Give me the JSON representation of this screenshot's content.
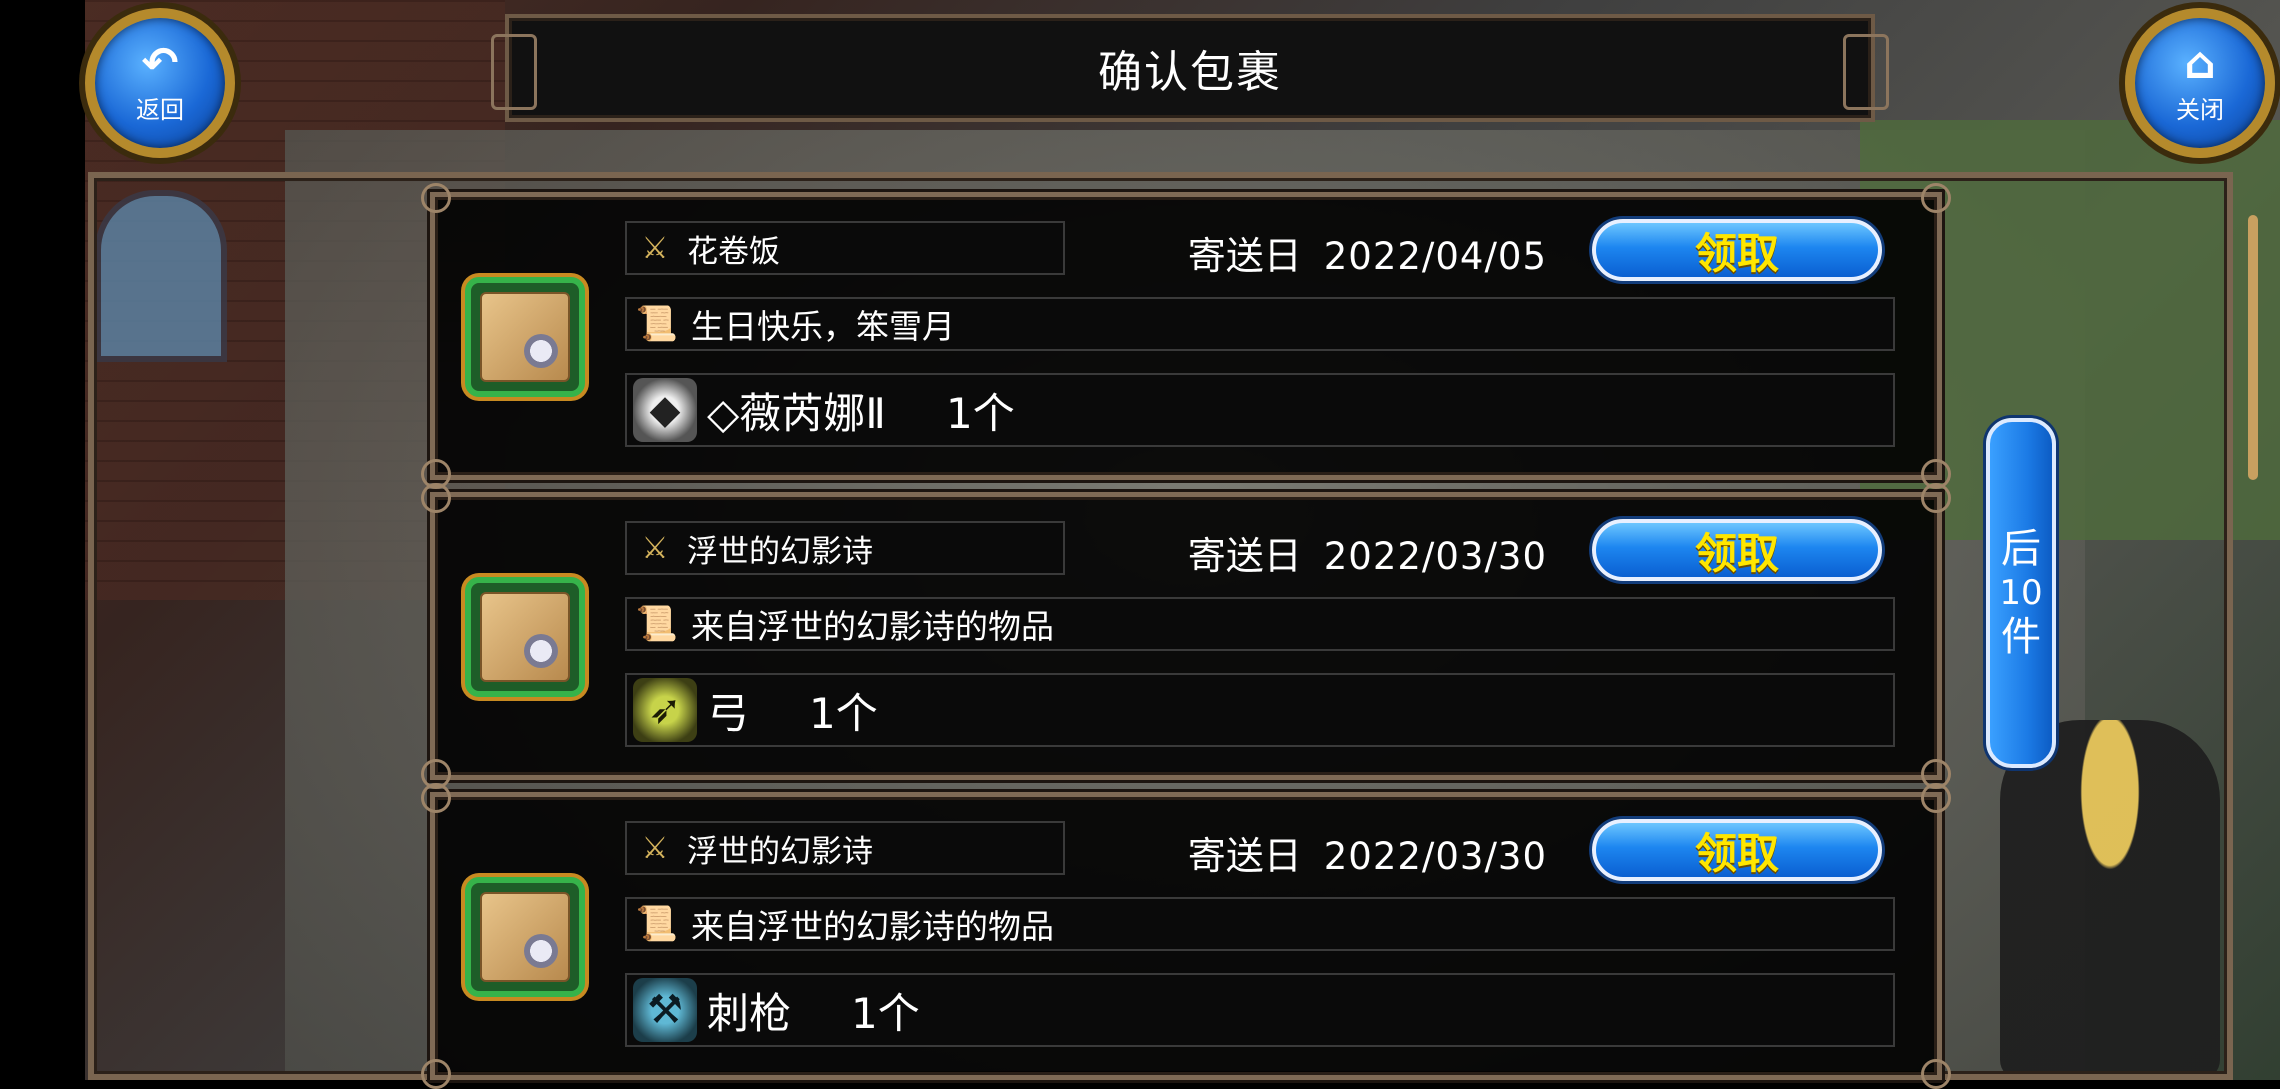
{
  "header": {
    "title": "确认包裹",
    "back_label": "返回",
    "close_label": "关闭",
    "back_icon": "back-arrow-icon",
    "close_icon": "home-icon"
  },
  "date_key": "寄送日",
  "claim_label": "领取",
  "next_page": {
    "prefix": "后",
    "count": "10",
    "suffix": "件"
  },
  "parcels": [
    {
      "sender": "花卷饭",
      "date": "2022/04/05",
      "message": "生日快乐，笨雪月",
      "item_name": "◇薇芮娜Ⅱ",
      "item_qty": "1个",
      "item_icon": "gem-icon"
    },
    {
      "sender": "浮世的幻影诗",
      "date": "2022/03/30",
      "message": "来自浮世的幻影诗的物品",
      "item_name": "弓",
      "item_qty": "1个",
      "item_icon": "bow-icon"
    },
    {
      "sender": "浮世的幻影诗",
      "date": "2022/03/30",
      "message": "来自浮世的幻影诗的物品",
      "item_name": "刺枪",
      "item_qty": "1个",
      "item_icon": "spear-icon"
    }
  ],
  "colors": {
    "accent_blue": "#1d86f0",
    "claim_text": "#ffe600",
    "frame": "#7f6a55",
    "parcel_border": "#36b34a"
  }
}
